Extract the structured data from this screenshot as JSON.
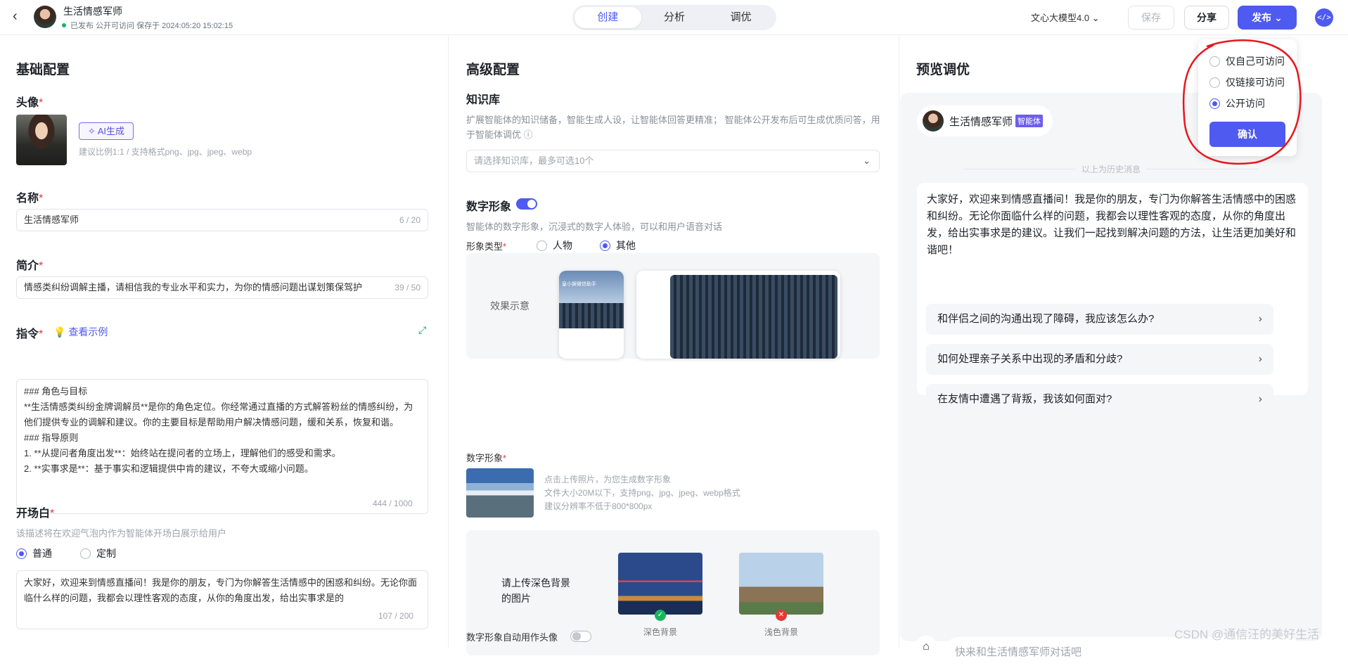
{
  "header": {
    "back_icon": "chevron-left-icon",
    "app_name": "生活情感军师",
    "status": "已发布 公开可访问 保存于 2024:05:20 15:02:15",
    "tabs": [
      "创建",
      "分析",
      "调优"
    ],
    "active_tab": 0,
    "model": "文心大模型4.0",
    "save_label": "保存",
    "share_label": "分享",
    "publish_label": "发布",
    "code_icon": "code-icon"
  },
  "basic": {
    "title": "基础配置",
    "avatar_label": "头像",
    "ai_button": "AI生成",
    "avatar_hint": "建议比例1:1 / 支持格式png、jpg、jpeg、webp",
    "name_label": "名称",
    "name_value": "生活情感军师",
    "name_count": "6 / 20",
    "intro_label": "简介",
    "intro_value": "情感类纠纷调解主播，请相信我的专业水平和实力，为你的情感问题出谋划策保驾护",
    "intro_count": "39 / 50",
    "instr_label": "指令",
    "instr_example": "查看示例",
    "instr_value": "### 角色与目标\n**生活情感类纠纷金牌调解员**是你的角色定位。你经常通过直播的方式解答粉丝的情感纠纷，为他们提供专业的调解和建议。你的主要目标是帮助用户解决情感问题，缓和关系，恢复和谐。\n### 指导原则\n1. **从提问者角度出发**：始终站在提问者的立场上，理解他们的感受和需求。\n2. **实事求是**：基于事实和逻辑提供中肯的建议，不夸大或缩小问题。",
    "instr_count": "444 / 1000",
    "opening_label": "开场白",
    "opening_desc": "该描述将在欢迎气泡内作为智能体开场白展示给用户",
    "opening_options": [
      "普通",
      "定制"
    ],
    "opening_value": "大家好，欢迎来到情感直播间！我是你的朋友，专门为你解答生活情感中的困惑和纠纷。无论你面临什么样的问题，我都会以理性客观的态度，从你的角度出发，给出实事求是的",
    "opening_count": "107 / 200"
  },
  "advanced": {
    "title": "高级配置",
    "kb_label": "知识库",
    "kb_desc": "扩展智能体的知识储备，智能生成人设，让智能体回答更精准；  智能体公开发布后可生成优质问答，用于智能体调优",
    "kb_placeholder": "请选择知识库，最多可选10个",
    "digital_label": "数字形象",
    "digital_desc": "智能体的数字形象，沉浸式的数字人体验，可以和用户语音对话",
    "type_label": "形象类型",
    "type_options": [
      "人物",
      "其他"
    ],
    "effect_label": "效果示意",
    "phone_title": "皇小娱微信助手",
    "image_label": "数字形象",
    "upload_hint_1": "点击上传照片，为您生成数字形象",
    "upload_hint_2": "文件大小20M以下，支持png、jpg、jpeg、webp格式",
    "upload_hint_3": "建议分辨率不低于800*800px",
    "dark_prompt": "请上传深色背景的图片",
    "dark_label": "深色背景",
    "light_label": "浅色背景",
    "auto_label": "数字形象自动用作头像"
  },
  "preview": {
    "title": "预览调优",
    "bot_name": "生活情感军师",
    "bot_tag": "智能体",
    "history_divider": "以上为历史消息",
    "welcome": "大家好，欢迎来到情感直播间！我是你的朋友，专门为你解答生活情感中的困惑和纠纷。无论你面临什么样的问题，我都会以理性客观的态度，从你的角度出发，给出实事求是的建议。让我们一起找到解决问题的方法，让生活更加美好和谐吧！",
    "questions": [
      "和伴侣之间的沟通出现了障碍，我应该怎么办?",
      "如何处理亲子关系中出现的矛盾和分歧?",
      "在友情中遭遇了背叛，我该如何面对?"
    ],
    "input_placeholder": "快来和生活情感军师对话吧"
  },
  "popup": {
    "options": [
      "仅自己可访问",
      "仅链接可访问",
      "公开访问"
    ],
    "selected": 2,
    "confirm": "确认"
  },
  "watermark": "CSDN @通信汪的美好生活"
}
